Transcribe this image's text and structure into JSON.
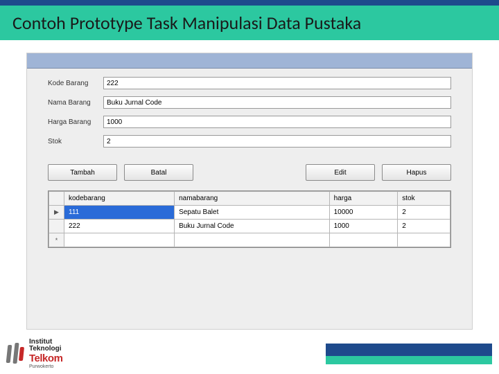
{
  "slide": {
    "title": "Contoh Prototype Task Manipulasi Data Pustaka"
  },
  "form": {
    "fields": [
      {
        "label": "Kode Barang",
        "value": "222"
      },
      {
        "label": "Nama Barang",
        "value": "Buku Jurnal Code"
      },
      {
        "label": "Harga Barang",
        "value": "1000"
      },
      {
        "label": "Stok",
        "value": "2"
      }
    ]
  },
  "buttons": {
    "tambah": "Tambah",
    "batal": "Batal",
    "edit": "Edit",
    "hapus": "Hapus"
  },
  "grid": {
    "columns": [
      "kodebarang",
      "namabarang",
      "harga",
      "stok"
    ],
    "rows": [
      {
        "marker": "▶",
        "selected": true,
        "cells": [
          "111",
          "Sepatu Balet",
          "10000",
          "2"
        ]
      },
      {
        "marker": "",
        "selected": false,
        "cells": [
          "222",
          "Buku Jurnal Code",
          "1000",
          "2"
        ]
      },
      {
        "marker": "*",
        "selected": false,
        "cells": [
          "",
          "",
          "",
          ""
        ]
      }
    ]
  },
  "logo": {
    "line1": "Institut",
    "line2": "Teknologi",
    "line3": "Telkom",
    "line4": "Purwokerto"
  }
}
